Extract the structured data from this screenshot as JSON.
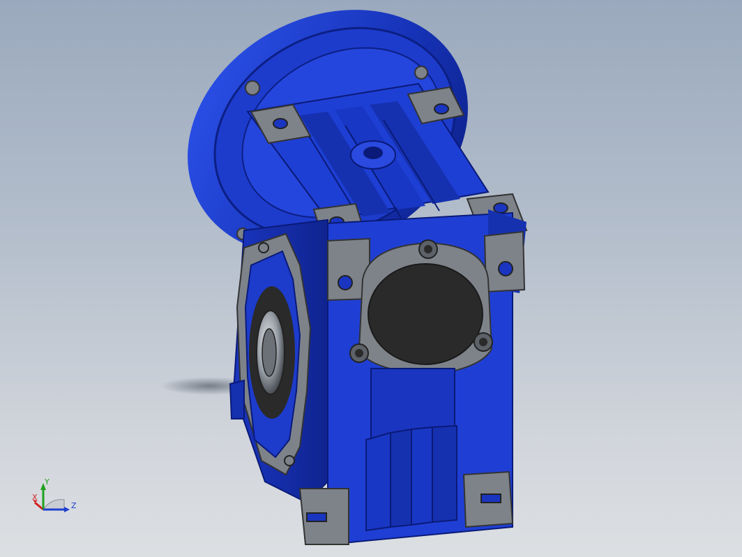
{
  "viewport": {
    "background_top": "#9aa9bd",
    "background_bottom": "#dcdfe2"
  },
  "model": {
    "colors": {
      "housing": "#1f3fd0",
      "housing_dark": "#122aa0",
      "housing_shadow": "#0a1a78",
      "machined_face": "#7e838a",
      "machined_dark": "#5d6168",
      "bore": "#2a2a2a",
      "bearing": "#9da3aa"
    }
  },
  "triad": {
    "x_label": "X",
    "y_label": "Y",
    "z_label": "Z",
    "x_color": "#d42020",
    "y_color": "#1fa01f",
    "z_color": "#1f3fd0"
  }
}
